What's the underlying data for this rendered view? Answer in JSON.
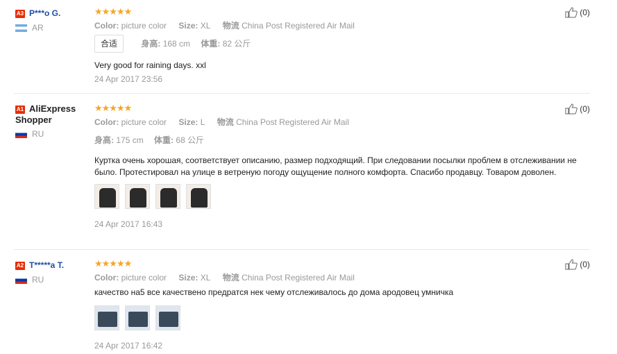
{
  "reviews": [
    {
      "level": "A3",
      "name": "P***o G.",
      "country": "AR",
      "stars": "★★★★★",
      "color_label": "Color:",
      "color_value": "picture color",
      "size_label": "Size:",
      "size_value": "XL",
      "ship_label": "物流",
      "ship_value": "China Post Registered Air Mail",
      "fit": "合适",
      "height_label": "身高:",
      "height_value": "168 cm",
      "weight_label": "体重:",
      "weight_value": "82 公斤",
      "text": "Very good for raining days. xxl",
      "date": "24 Apr 2017 23:56",
      "likes": "(0)"
    },
    {
      "level": "A1",
      "name": "AliExpress Shopper",
      "country": "RU",
      "stars": "★★★★★",
      "color_label": "Color:",
      "color_value": "picture color",
      "size_label": "Size:",
      "size_value": "L",
      "ship_label": "物流",
      "ship_value": "China Post Registered Air Mail",
      "height_label": "身高:",
      "height_value": "175 cm",
      "weight_label": "体重:",
      "weight_value": "68 公斤",
      "text": "Куртка очень хорошая, соответствует описанию, размер подходящий. При следовании посылки проблем в отслеживании не было. Протестировал на улице в ветреную погоду ощущение полного комфорта. Спасибо продавцу. Товаром доволен.",
      "date": "24 Apr 2017 16:43",
      "likes": "(0)"
    },
    {
      "level": "A2",
      "name": "T*****a T.",
      "country": "RU",
      "stars": "★★★★★",
      "color_label": "Color:",
      "color_value": "picture color",
      "size_label": "Size:",
      "size_value": "XL",
      "ship_label": "物流",
      "ship_value": "China Post Registered Air Mail",
      "text": "качество на5 все качествено предратся нек чему отслеживалось до дома ародовец умничка",
      "date": "24 Apr 2017 16:42",
      "likes": "(0)"
    }
  ]
}
